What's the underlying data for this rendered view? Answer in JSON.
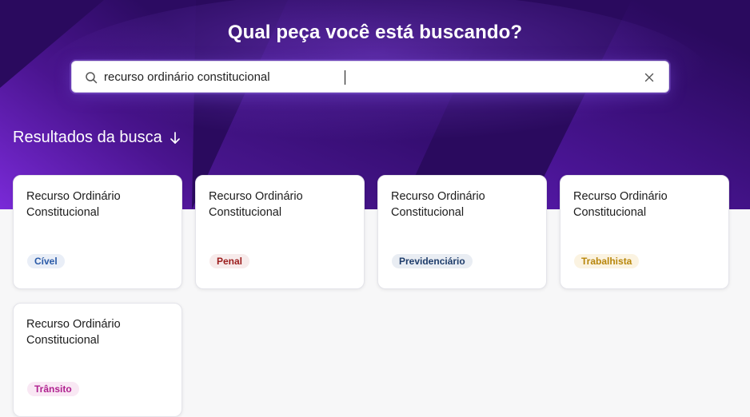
{
  "header": {
    "title": "Qual peça você está buscando?"
  },
  "search": {
    "value": "recurso ordinário constitucional",
    "icon": "search-icon",
    "clear_icon": "close-icon"
  },
  "results": {
    "heading": "Resultados da busca",
    "heading_icon": "arrow-down-icon",
    "cards": [
      {
        "title_line1": "Recurso Ordinário",
        "title_line2": "Constitucional",
        "tag": "Cível",
        "tag_color": "#2a5aa8",
        "tag_bg": "#e9eef7"
      },
      {
        "title_line1": "Recurso Ordinário",
        "title_line2": "Constitucional",
        "tag": "Penal",
        "tag_color": "#9b1c1c",
        "tag_bg": "#f7ebeb"
      },
      {
        "title_line1": "Recurso Ordinário",
        "title_line2": "Constitucional",
        "tag": "Previdenciário",
        "tag_color": "#1f3d6b",
        "tag_bg": "#e9edf3"
      },
      {
        "title_line1": "Recurso Ordinário",
        "title_line2": "Constitucional",
        "tag": "Trabalhista",
        "tag_color": "#b8860b",
        "tag_bg": "#fbf3e1"
      },
      {
        "title_line1": "Recurso Ordinário",
        "title_line2": "Constitucional",
        "tag": "Trânsito",
        "tag_color": "#b0208f",
        "tag_bg": "#f9e8f4"
      }
    ]
  },
  "colors": {
    "hero_bg": "#2a0a5e",
    "accent": "#7b2ad6",
    "page_bg": "#f7f7f8"
  }
}
